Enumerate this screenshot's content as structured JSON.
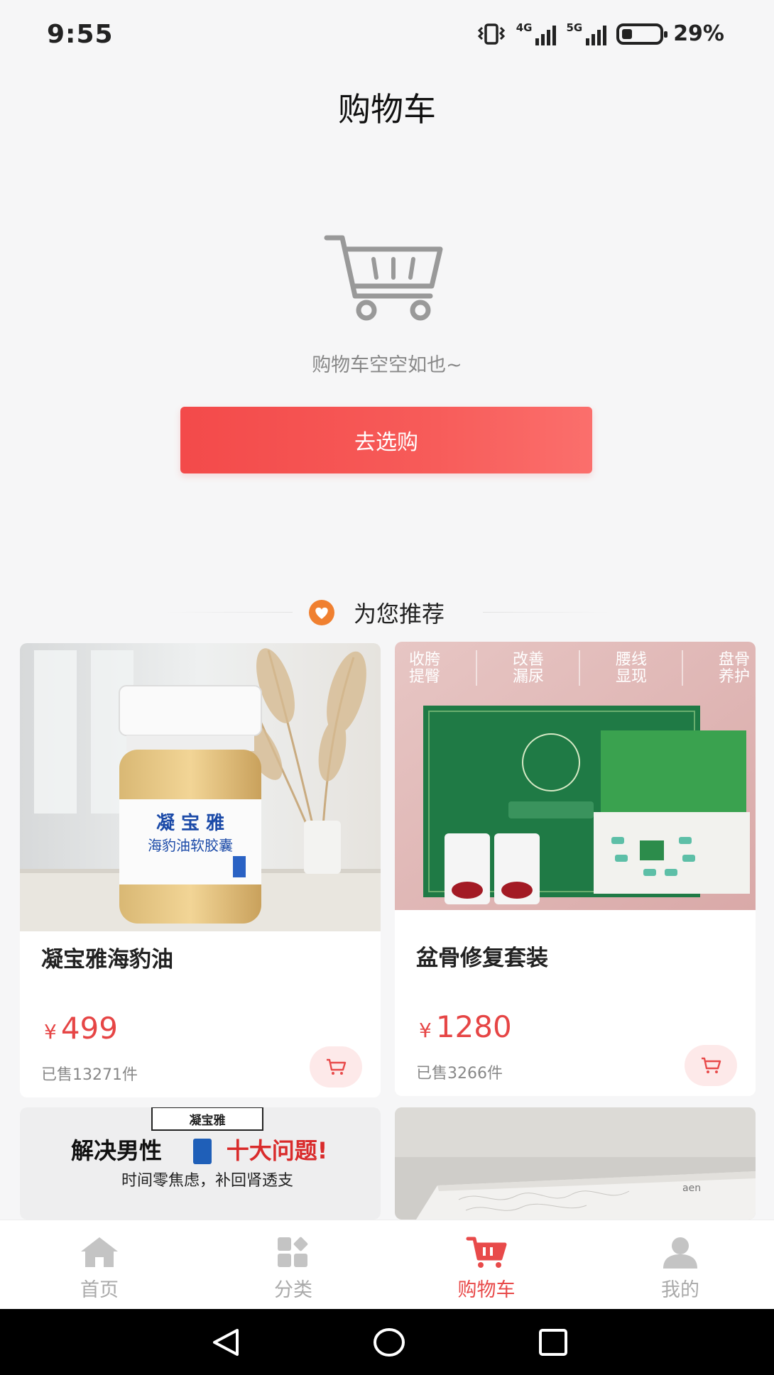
{
  "status": {
    "time": "9:55",
    "net1": "4G",
    "net2": "5G",
    "battery": "29%"
  },
  "header": {
    "title": "购物车"
  },
  "empty": {
    "message": "购物车空空如也~",
    "button_label": "去选购"
  },
  "recommend": {
    "title": "为您推荐",
    "products": [
      {
        "name": "凝宝雅海豹油",
        "currency": "¥",
        "price": "499",
        "sold": "已售13271件",
        "image_text": [
          "凝宝雅",
          "海豹油软胶囊"
        ]
      },
      {
        "name": "盆骨修复套装",
        "currency": "¥",
        "price": "1280",
        "sold": "已售3266件",
        "image_text": [
          "收胯提臀",
          "改善漏尿",
          "腰线显现",
          "盘骨养护"
        ]
      },
      {
        "name": "",
        "image_text": [
          "凝宝雅",
          "解决男性",
          "十大问题!",
          "时间零焦虑，补回肾透支"
        ]
      },
      {
        "name": "",
        "image_text": []
      }
    ]
  },
  "tabbar": {
    "items": [
      {
        "label": "首页",
        "icon": "home-icon"
      },
      {
        "label": "分类",
        "icon": "category-icon"
      },
      {
        "label": "购物车",
        "icon": "cart-icon",
        "active": true
      },
      {
        "label": "我的",
        "icon": "profile-icon"
      }
    ]
  },
  "colors": {
    "accent": "#e84a4a",
    "button": "#f34a4a",
    "page_bg": "#f6f6f7"
  }
}
